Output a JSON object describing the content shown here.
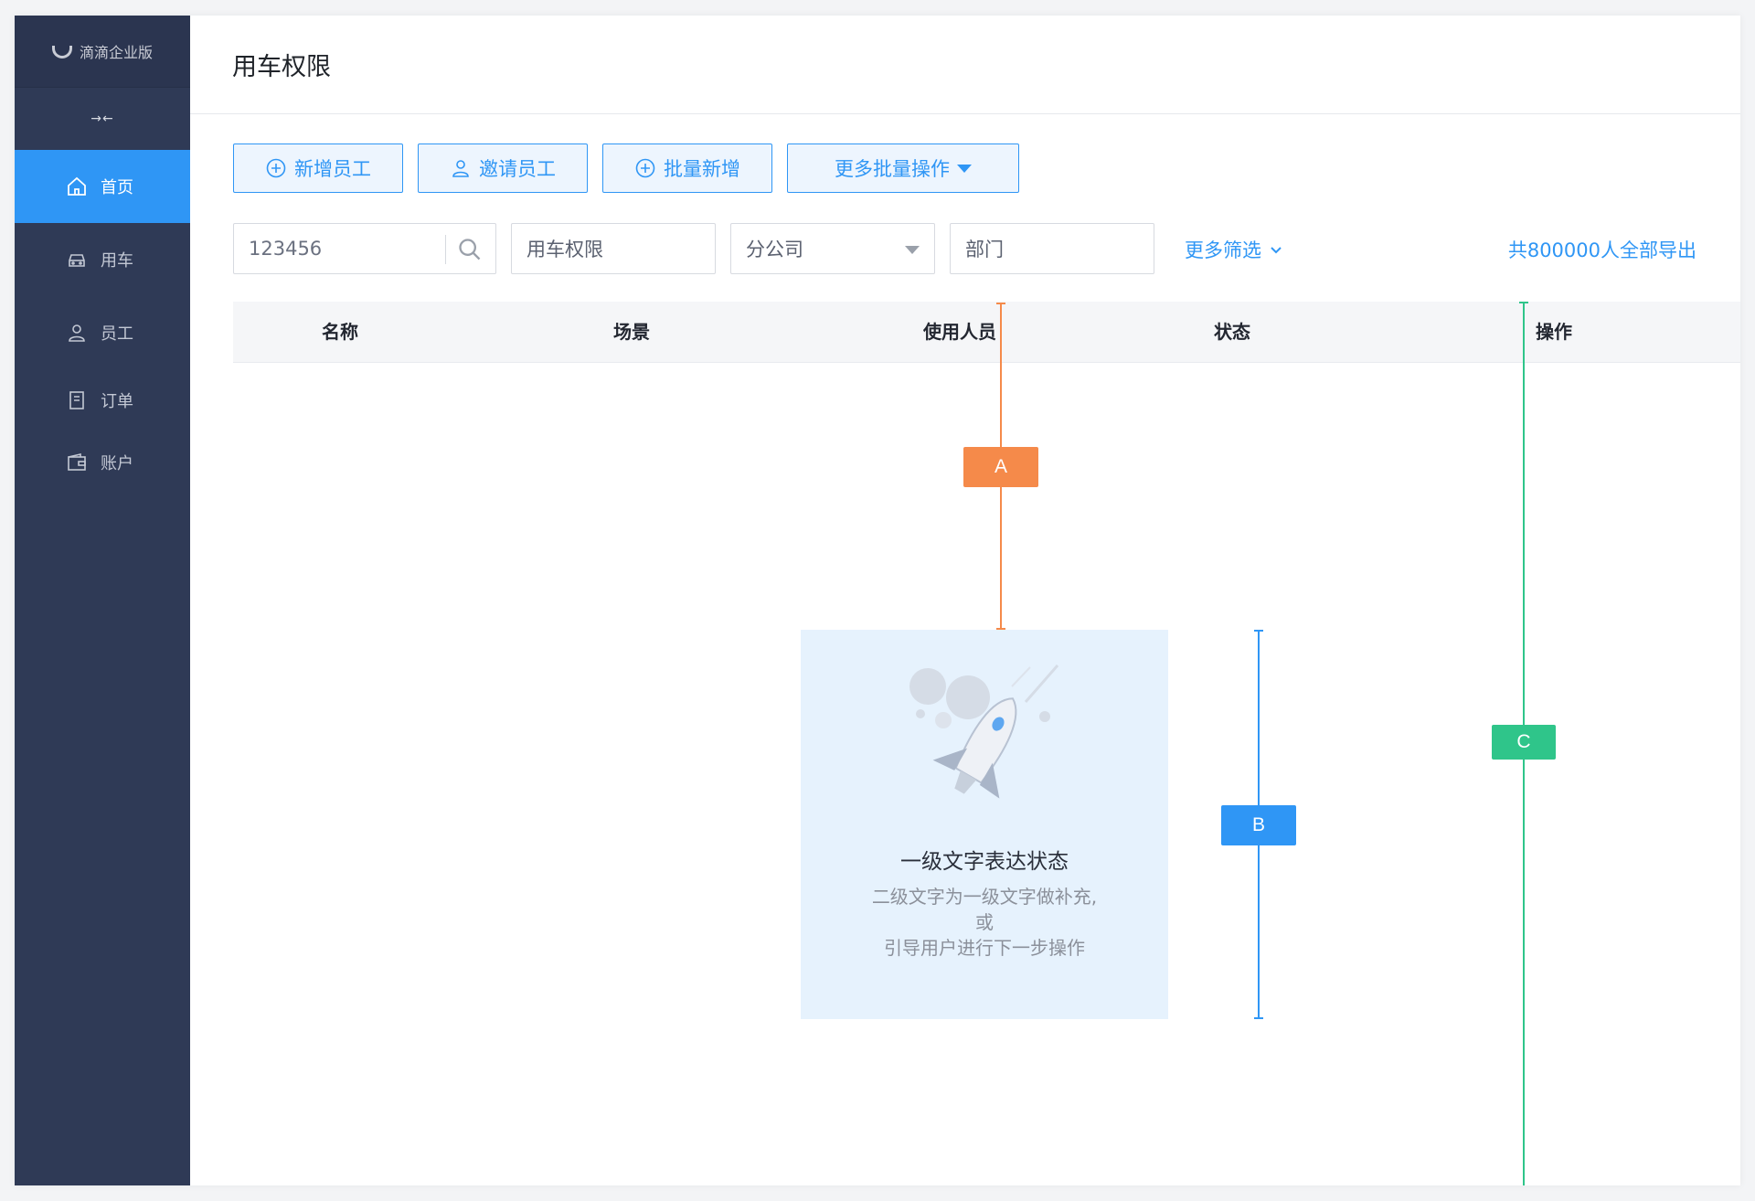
{
  "brand": {
    "name": "滴滴企业版"
  },
  "sidebar": {
    "collapse_glyph": "→←",
    "items": [
      {
        "label": "首页",
        "icon": "home-icon",
        "active": true
      },
      {
        "label": "用车",
        "icon": "car-icon"
      },
      {
        "label": "员工",
        "icon": "user-icon"
      },
      {
        "label": "订单",
        "icon": "order-icon"
      },
      {
        "label": "账户",
        "icon": "wallet-icon"
      }
    ]
  },
  "page": {
    "title": "用车权限"
  },
  "toolbar": {
    "add_employee": "新增员工",
    "invite_employee": "邀请员工",
    "batch_add": "批量新增",
    "more_batch": "更多批量操作"
  },
  "filters": {
    "search_value": "123456",
    "permission_value": "用车权限",
    "branch_value": "分公司",
    "department_value": "部门",
    "more_filters": "更多筛选",
    "export": "共800000人全部导出"
  },
  "table": {
    "columns": [
      "名称",
      "场景",
      "使用人员",
      "状态",
      "操作"
    ]
  },
  "empty_state": {
    "title": "一级文字表达状态",
    "desc_line1": "二级文字为一级文字做补充,",
    "desc_line2": "或",
    "desc_line3": "引导用户进行下一步操作"
  },
  "annotations": {
    "a": {
      "label": "A",
      "color": "#f58a4a"
    },
    "b": {
      "label": "B",
      "color": "#2f96f5"
    },
    "c": {
      "label": "C",
      "color": "#2fc58a"
    }
  },
  "colors": {
    "sidebar_bg": "#2f3a56",
    "accent": "#2f96f5"
  }
}
